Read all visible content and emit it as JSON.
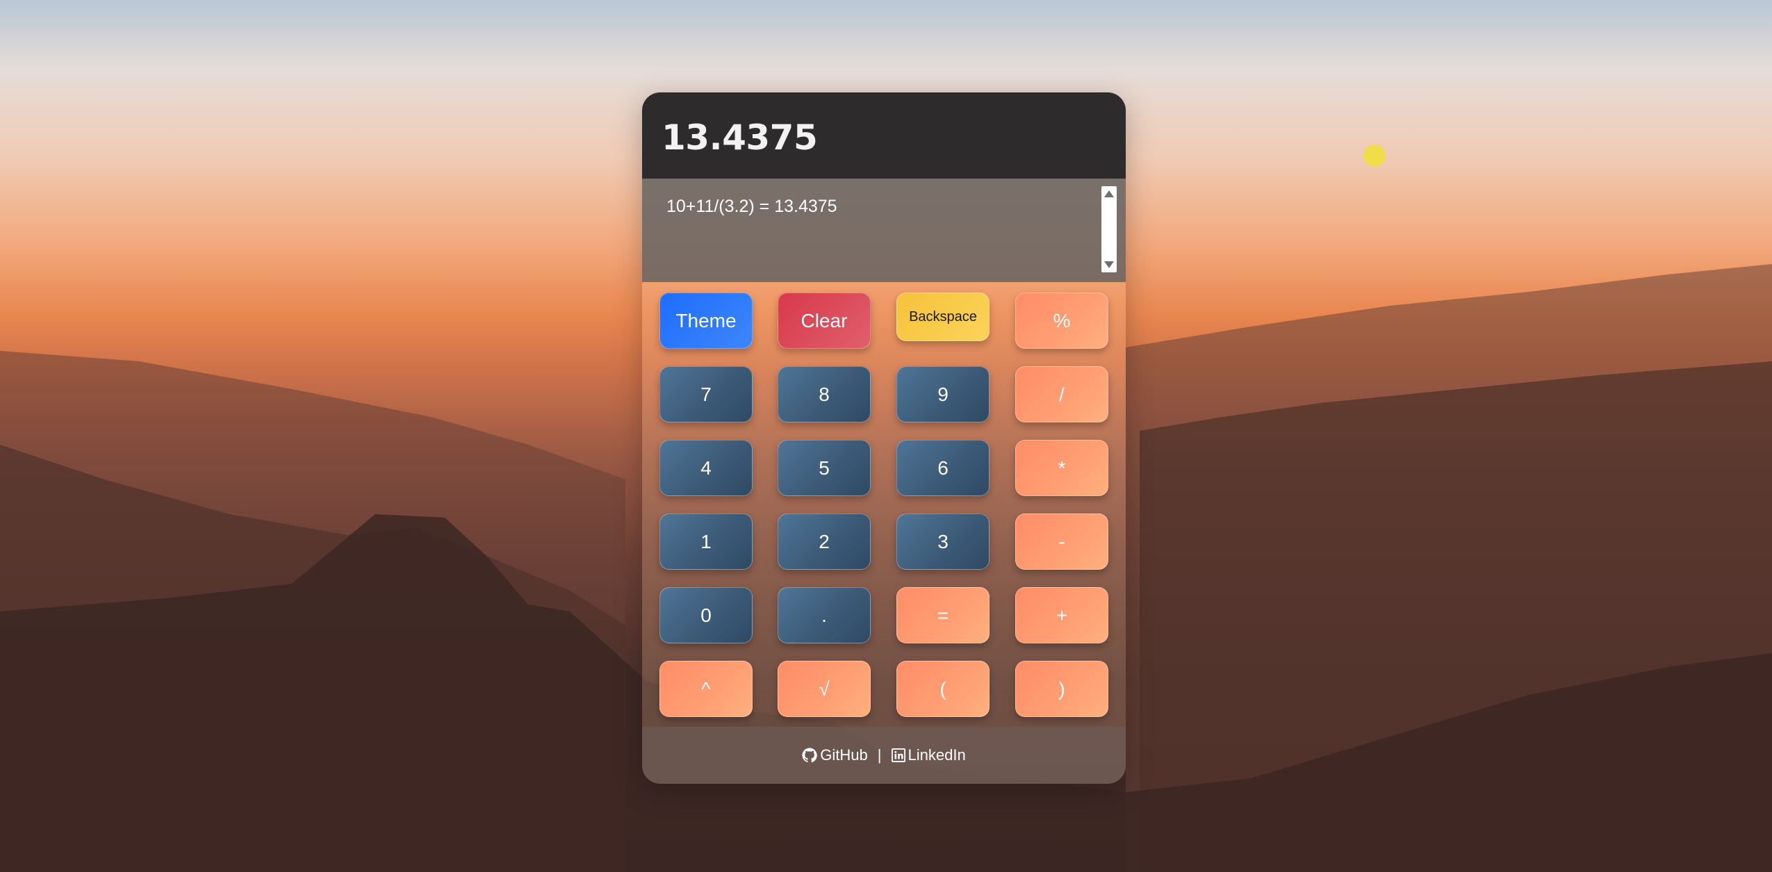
{
  "calculator": {
    "display_value": "13.4375",
    "history": [
      "10+11/(3.2) = 13.4375"
    ]
  },
  "buttons": {
    "theme": "Theme",
    "clear": "Clear",
    "backspace": "Backspace",
    "percent": "%",
    "seven": "7",
    "eight": "8",
    "nine": "9",
    "divide": "/",
    "four": "4",
    "five": "5",
    "six": "6",
    "multiply": "*",
    "one": "1",
    "two": "2",
    "three": "3",
    "minus": "-",
    "zero": "0",
    "decimal": ".",
    "equals": "=",
    "plus": "+",
    "power": "^",
    "sqrt": "√",
    "open_paren": "(",
    "close_paren": ")"
  },
  "footer": {
    "github_label": "GitHub",
    "separator": "|",
    "linkedin_label": "LinkedIn",
    "github_icon": "github-icon",
    "linkedin_icon": "linkedin-icon"
  },
  "colors": {
    "display_bg": "#2d2b2b",
    "number_button": "#3c5b78",
    "operator_button": "#ff9d73",
    "theme_button": "#1f6dfb",
    "clear_button": "#d7394b",
    "backspace_button": "#f6c23a"
  }
}
